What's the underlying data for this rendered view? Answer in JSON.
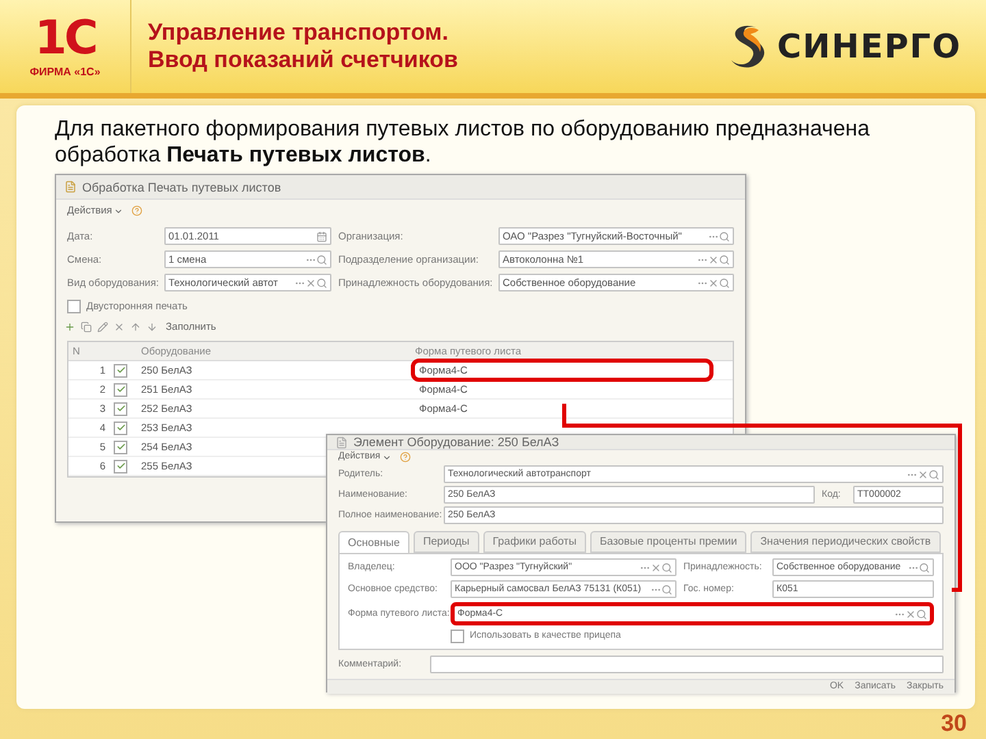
{
  "header": {
    "logo_mark": "1С",
    "logo_caption": "ФИРМА «1С»",
    "title_lines": [
      "Управление транспортом.",
      "Ввод показаний счетчиков"
    ],
    "brand": "СИНЕРГО"
  },
  "intro": "Для пакетного формирования путевых листов по оборудованию предназначена обработка **Печать путевых листов**.",
  "window_1": {
    "title": "Обработка Печать путевых листов",
    "menu": "Действия",
    "fields": [
      {
        "label": "Дата:",
        "value": "01.01.2011",
        "kind": "date"
      },
      {
        "label": "Организация:",
        "value": "ОАО \"Разрез \"Тугнуйский-Восточный\"",
        "kind": "select"
      },
      {
        "label": "Смена:",
        "value": "1 смена",
        "kind": "select"
      },
      {
        "label": "Подразделение организации:",
        "value": "Автоколонна №1",
        "kind": "clearable"
      },
      {
        "label": "Вид оборудования:",
        "value": "Технологический автот",
        "kind": "clearable"
      },
      {
        "label": "Принадлежность оборудования:",
        "value": "Собственное оборудование",
        "kind": "clearable"
      }
    ],
    "double_sided": {
      "label": "Двусторонняя печать",
      "checked": false
    },
    "fill_button": "Заполнить",
    "columns": [
      "N",
      "Оборудование",
      "Форма путевого листа"
    ],
    "rows": [
      {
        "n": "1",
        "checked": true,
        "equipment": "250 БелАЗ",
        "form": "Форма4-С",
        "highlighted": true
      },
      {
        "n": "2",
        "checked": true,
        "equipment": "251 БелАЗ",
        "form": "Форма4-С",
        "highlighted": false
      },
      {
        "n": "3",
        "checked": true,
        "equipment": "252 БелАЗ",
        "form": "Форма4-С",
        "highlighted": false
      },
      {
        "n": "4",
        "checked": true,
        "equipment": "253 БелАЗ"
      },
      {
        "n": "5",
        "checked": true,
        "equipment": "254 БелАЗ"
      },
      {
        "n": "6",
        "checked": true,
        "equipment": "255 БелАЗ"
      }
    ]
  },
  "window_2": {
    "title": "Элемент Оборудование: 250 БелАЗ",
    "menu": "Действия",
    "parent": {
      "label": "Родитель:",
      "value": "Технологический автотранспорт"
    },
    "name": {
      "label": "Наименование:",
      "value": "250 БелАЗ"
    },
    "code": {
      "label": "Код:",
      "value": "ТТ000002"
    },
    "full_name": {
      "label": "Полное наименование:",
      "value": "250 БелАЗ"
    },
    "tabs": [
      {
        "label": "Основные",
        "selected": true
      },
      {
        "label": "Периоды",
        "selected": false
      },
      {
        "label": "Графики работы",
        "selected": false
      },
      {
        "label": "Базовые проценты премии",
        "selected": false
      },
      {
        "label": "Значения периодических свойств",
        "selected": false
      }
    ],
    "owner": {
      "label": "Владелец:",
      "value": "ООО \"Разрез \"Тугнуйский\""
    },
    "belonging": {
      "label": "Принадлежность:",
      "value": "Собственное оборудование"
    },
    "asset": {
      "label": "Основное средство:",
      "value": "Карьерный самосвал БелАЗ 75131 (К051)"
    },
    "plate": {
      "label": "Гос. номер:",
      "value": "К051"
    },
    "form": {
      "label": "Форма путевого листа:",
      "value": "Форма4-С",
      "highlighted": true
    },
    "trailer": {
      "label": "Использовать в качестве прицепа",
      "checked": false
    },
    "comment": {
      "label": "Комментарий:"
    },
    "buttons": [
      "OK",
      "Записать",
      "Закрыть"
    ]
  },
  "page_number": "30"
}
